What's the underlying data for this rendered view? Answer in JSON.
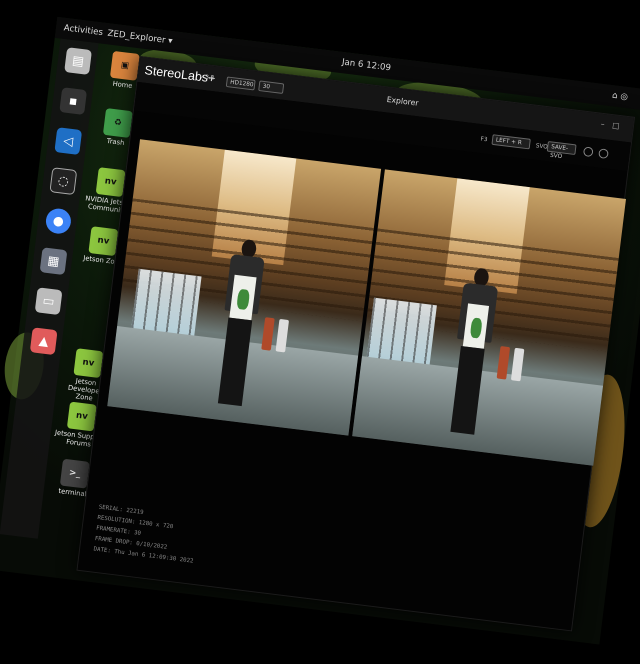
{
  "topbar": {
    "activities": "Activities",
    "app_menu": "ZED_Explorer ▾",
    "clock": "Jan 6  12:09"
  },
  "window": {
    "brand": "StereoLabs",
    "brand_mark": "+",
    "version": "v 3.8",
    "title": "Explorer",
    "resolution_select": "HD1280",
    "fps_select": "30",
    "view_label": "F3",
    "view_select": "LEFT + R",
    "record_label": "SVO",
    "record_select": "SAVE-SVO"
  },
  "desktop": {
    "icons": [
      {
        "label": "Home",
        "icon": "folder-icon"
      },
      {
        "label": "Trash",
        "icon": "trash-icon"
      },
      {
        "label": "NVIDIA Jetson Community",
        "icon": "nvidia-icon"
      },
      {
        "label": "Jetson Zoo",
        "icon": "nvidia-icon"
      },
      {
        "label": "Jetson Developer Zone",
        "icon": "nvidia-icon"
      },
      {
        "label": "Jetson Support Forums",
        "icon": "nvidia-icon"
      },
      {
        "label": "terminal",
        "icon": "terminal-icon"
      }
    ],
    "dock": [
      {
        "icon": "files-icon"
      },
      {
        "icon": "terminal-icon"
      },
      {
        "icon": "vscode-icon"
      },
      {
        "icon": "settings-icon"
      },
      {
        "icon": "chromium-icon"
      },
      {
        "icon": "app-grid-icon"
      },
      {
        "icon": "usb-drive-icon"
      },
      {
        "icon": "rocket-icon"
      }
    ]
  },
  "info": {
    "serial": "SERIAL:  22219",
    "resolution": "RESOLUTION:  1280 x 720",
    "framerate": "FRAMERATE:  30",
    "frame_drop": "FRAME DROP:  0/10/2022",
    "date": "DATE:  Thu Jan 6 12:09:30 2022"
  }
}
